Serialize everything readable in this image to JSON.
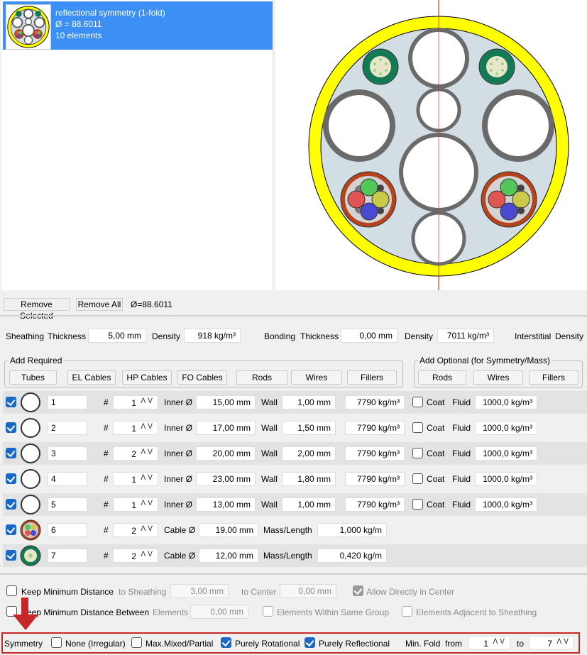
{
  "result": {
    "title": "reflectional symmetry (1-fold)",
    "diameter": "Ø = 88.6011",
    "elements": "10 elements"
  },
  "toolbar": {
    "remove_selected": "Remove Selected",
    "remove_all": "Remove All",
    "diameter": "Ø=88.6011"
  },
  "sheathing": {
    "label": "Sheathing",
    "thickness_label": "Thickness",
    "thickness": "5,00 mm",
    "density_label": "Density",
    "density": "918 kg/m³"
  },
  "bonding": {
    "label": "Bonding",
    "thickness_label": "Thickness",
    "thickness": "0,00 mm",
    "density_label": "Density",
    "density": "7011 kg/m³"
  },
  "interstitial": {
    "label": "Interstitial",
    "density_label": "Density"
  },
  "add_required": {
    "label": "Add Required",
    "buttons": [
      "Tubes",
      "EL Cables",
      "HP Cables",
      "FO Cables",
      "Rods",
      "Wires",
      "Fillers"
    ]
  },
  "add_optional": {
    "label": "Add Optional (for Symmetry/Mass)",
    "buttons": [
      "Rods",
      "Wires",
      "Fillers"
    ]
  },
  "labels": {
    "hash": "#",
    "inner": "Inner Ø",
    "wall": "Wall",
    "coat": "Coat",
    "fluid": "Fluid",
    "cable": "Cable Ø",
    "mass": "Mass/Length"
  },
  "tube_rows": [
    {
      "name": "1",
      "count": "1",
      "inner": "15,00 mm",
      "wall": "1,00 mm",
      "density": "7790 kg/m³",
      "fluid": "1000,0 kg/m³"
    },
    {
      "name": "2",
      "count": "1",
      "inner": "17,00 mm",
      "wall": "1,50 mm",
      "density": "7790 kg/m³",
      "fluid": "1000,0 kg/m³"
    },
    {
      "name": "3",
      "count": "2",
      "inner": "20,00 mm",
      "wall": "2,00 mm",
      "density": "7790 kg/m³",
      "fluid": "1000,0 kg/m³"
    },
    {
      "name": "4",
      "count": "1",
      "inner": "23,00 mm",
      "wall": "1,80 mm",
      "density": "7790 kg/m³",
      "fluid": "1000,0 kg/m³"
    },
    {
      "name": "5",
      "count": "1",
      "inner": "13,00 mm",
      "wall": "1,00 mm",
      "density": "7790 kg/m³",
      "fluid": "1000,0 kg/m³"
    }
  ],
  "cable_rows": [
    {
      "name": "6",
      "count": "2",
      "cable": "19,00 mm",
      "mass": "1,000 kg/m"
    },
    {
      "name": "7",
      "count": "2",
      "cable": "12,00 mm",
      "mass": "0,420 kg/m"
    }
  ],
  "distance": {
    "keep_min": "Keep Minimum Distance",
    "to_sheathing": "to Sheathing",
    "to_sheathing_value": "3,00 mm",
    "to_center": "to Center",
    "to_center_value": "0,00 mm",
    "allow_center": "Allow Directly in Center",
    "keep_between": "Keep Minimum Distance Between",
    "elements": "Elements",
    "elements_value": "0,00 mm",
    "same_group": "Elements Within Same Group",
    "adjacent": "Elements Adjacent to Sheathing"
  },
  "symmetry": {
    "label": "Symmetry",
    "none": "None (Irregular)",
    "mixed": "Max.Mixed/Partial",
    "rotational": "Purely Rotational",
    "reflectional": "Purely Reflectional",
    "min_fold": "Min. Fold",
    "from": "from",
    "from_value": "1",
    "to": "to",
    "to_value": "7"
  },
  "colors": {
    "selection": "#3b8ff5",
    "sheath": "#ffff00",
    "accent": "#1a69c4",
    "arrow": "#c62828"
  }
}
